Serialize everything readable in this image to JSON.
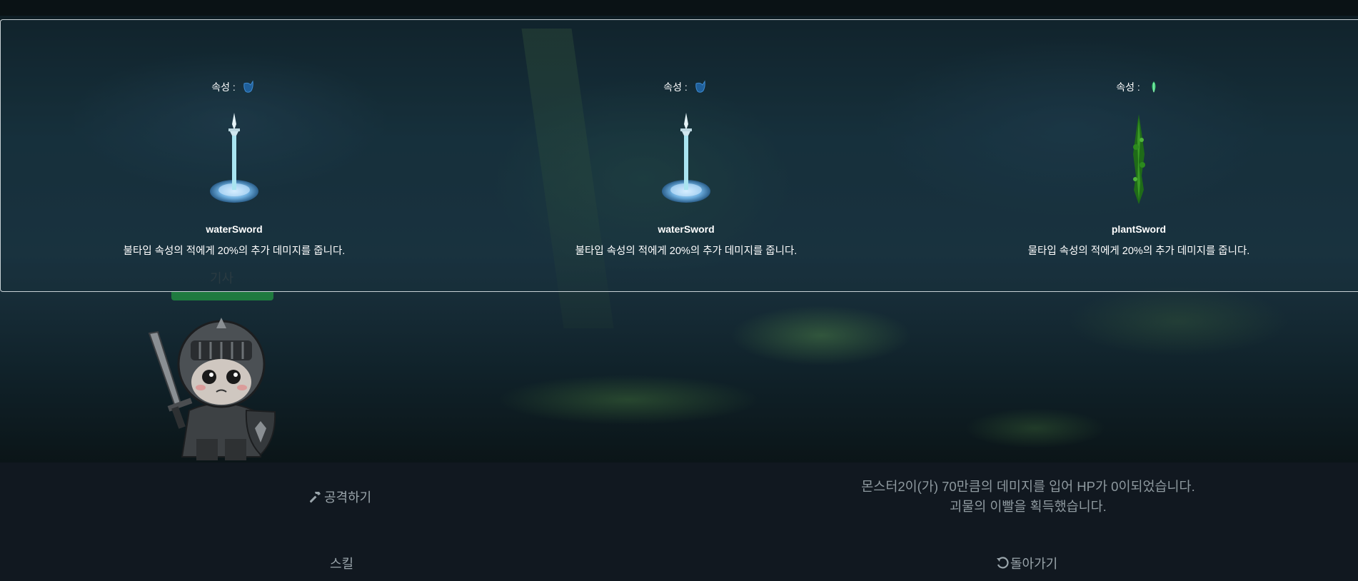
{
  "equipment_panel": {
    "attribute_label": "속성 :",
    "items": [
      {
        "element_icon": "water-drop-icon",
        "sword_image": "water-sword",
        "name": "waterSword",
        "description": "불타입 속성의 적에게 20%의 추가 데미지를 줍니다."
      },
      {
        "element_icon": "water-drop-icon",
        "sword_image": "water-sword",
        "name": "waterSword",
        "description": "불타입 속성의 적에게 20%의 추가 데미지를 줍니다."
      },
      {
        "element_icon": "leaf-icon",
        "sword_image": "plant-sword",
        "name": "plantSword",
        "description": "물타입 속성의 적에게 20%의 추가 데미지를 줍니다."
      }
    ]
  },
  "player": {
    "class_label": "기사",
    "hp_fraction": 1.0,
    "hp_color": "#1f7a3f"
  },
  "actions": {
    "attack_label": "공격하기",
    "attack_icon": "hammer-icon",
    "skill_label": "스킬",
    "back_label": "돌아가기",
    "back_icon": "undo-icon"
  },
  "battle_log": {
    "message": "몬스터2이(가) 70만큼의 데미지를 입어 HP가 0이되었습니다. 괴물의 이빨을 획득했습니다."
  }
}
